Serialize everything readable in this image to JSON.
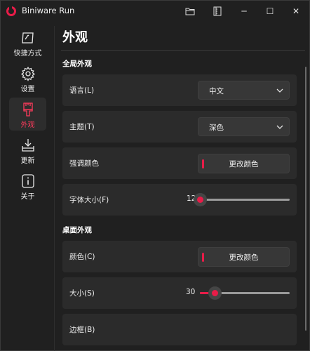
{
  "window": {
    "title": "Biniware Run",
    "controls": {
      "folder_icon": "folder-icon",
      "archive_icon": "archive-icon",
      "minimize": "─",
      "maximize": "☐",
      "close": "✕"
    }
  },
  "sidebar": {
    "items": [
      {
        "label": "快捷方式",
        "icon": "shortcut-icon",
        "active": false
      },
      {
        "label": "设置",
        "icon": "gear-icon",
        "active": false
      },
      {
        "label": "外观",
        "icon": "brush-icon",
        "active": true
      },
      {
        "label": "更新",
        "icon": "download-icon",
        "active": false
      },
      {
        "label": "关于",
        "icon": "info-icon",
        "active": false
      }
    ]
  },
  "main": {
    "title": "外观",
    "global_section": {
      "title": "全局外观",
      "language": {
        "label": "语言(L)",
        "value": "中文"
      },
      "theme": {
        "label": "主题(T)",
        "value": "深色"
      },
      "accent": {
        "label": "强调颜色",
        "button": "更改颜色"
      },
      "font_size": {
        "label": "字体大小(F)",
        "value": "12",
        "level": 0
      }
    },
    "desktop_section": {
      "title": "桌面外观",
      "color": {
        "label": "颜色(C)",
        "button": "更改颜色"
      },
      "size": {
        "label": "大小(S)",
        "value": "30",
        "level": 0.17
      },
      "border": {
        "label": "边框(B)"
      }
    }
  },
  "colors": {
    "accent": "#e81c48",
    "background": "#202020",
    "card": "#2b2b2b"
  }
}
